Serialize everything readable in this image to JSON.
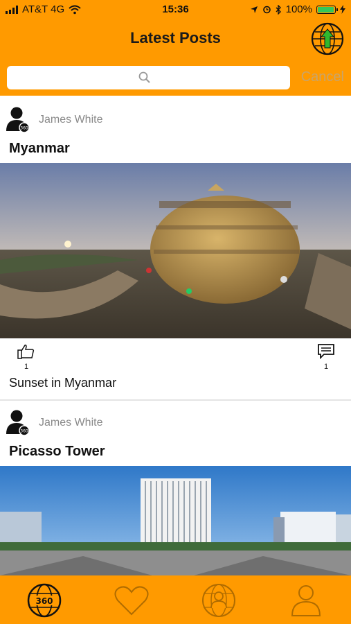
{
  "status": {
    "carrier": "AT&T 4G",
    "time": "15:36",
    "battery": "100%"
  },
  "header": {
    "title": "Latest Posts",
    "upload_icon": "globe-upload-icon"
  },
  "search": {
    "placeholder": "",
    "cancel_label": "Cancel"
  },
  "posts": [
    {
      "author": "James White",
      "title": "Myanmar",
      "likes": "1",
      "comments": "1",
      "caption": "Sunset in Myanmar"
    },
    {
      "author": "James White",
      "title": "Picasso Tower"
    }
  ],
  "tabs": [
    {
      "name": "home-360",
      "icon": "globe-360-icon",
      "active": true
    },
    {
      "name": "favorites",
      "icon": "heart-icon"
    },
    {
      "name": "explore",
      "icon": "globe-person-icon"
    },
    {
      "name": "profile",
      "icon": "person-icon"
    }
  ],
  "colors": {
    "accent": "#ff9a00",
    "cancel": "#c9a46a",
    "upload_arrow": "#2eb82e"
  }
}
